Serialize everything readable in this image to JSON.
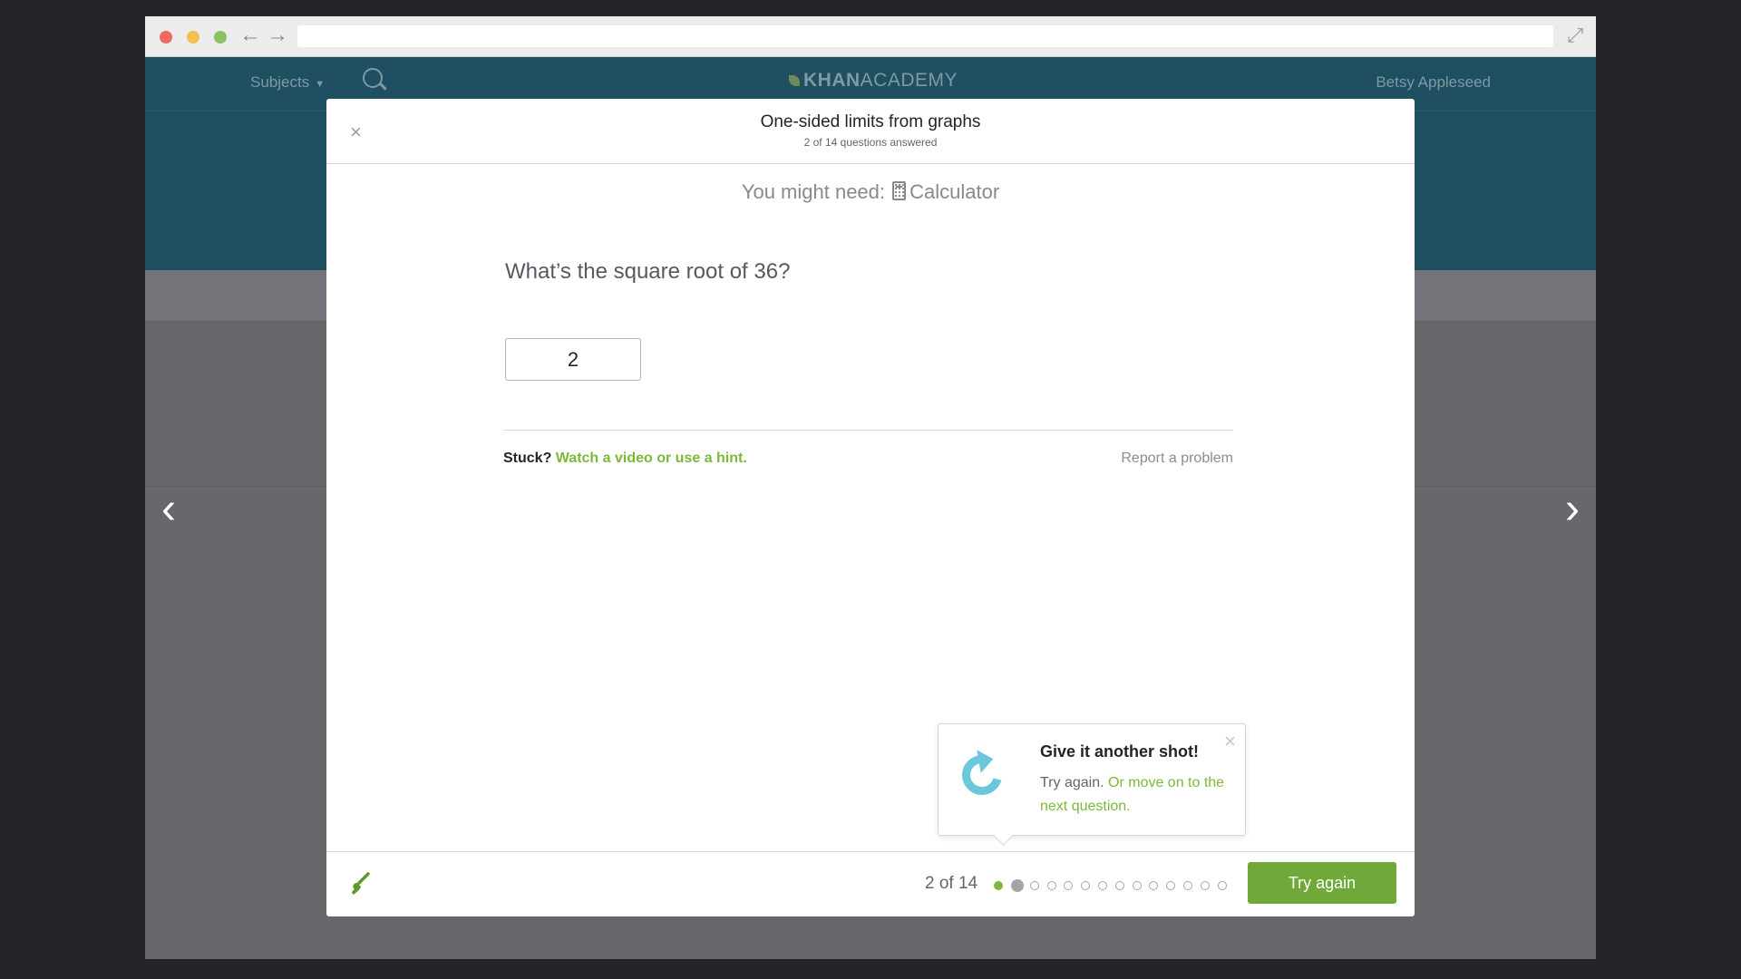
{
  "browser": {
    "back_icon": "←",
    "forward_icon": "→",
    "expand_icon": "⤢"
  },
  "site": {
    "subjects_label": "Subjects",
    "logo_bold": "KHAN",
    "logo_light": "ACADEMY",
    "user_name": "Betsy Appleseed"
  },
  "modal": {
    "title": "One-sided limits from graphs",
    "subtitle": "2 of 14 questions answered",
    "close_icon": "×",
    "need_label": "You might need:",
    "need_tool": "Calculator",
    "question": "What’s the square root of 36?",
    "answer_value": "2",
    "stuck_label": "Stuck?",
    "hint_link": "Watch a video or use a hint.",
    "report_link": "Report a problem"
  },
  "toast": {
    "title": "Give it another shot!",
    "body_text": "Try again.",
    "body_link": "Or move on to the next question.",
    "close_icon": "×"
  },
  "footer": {
    "progress_label": "2 of 14",
    "total_questions": 14,
    "completed": 1,
    "current_index": 2,
    "button_label": "Try again"
  },
  "nav": {
    "prev_icon": "‹",
    "next_icon": "›"
  },
  "colors": {
    "accent_green": "#71a83a",
    "link_green": "#7db83a",
    "header_blue": "#1f4f60",
    "retry_blue": "#6cc6dc"
  },
  "icons": {
    "traffic_lights": [
      "close-dot",
      "minimize-dot",
      "zoom-dot"
    ],
    "retry": "refresh-icon",
    "scratchpad": "brush-icon",
    "search": "search-icon",
    "calculator": "calculator-icon"
  }
}
